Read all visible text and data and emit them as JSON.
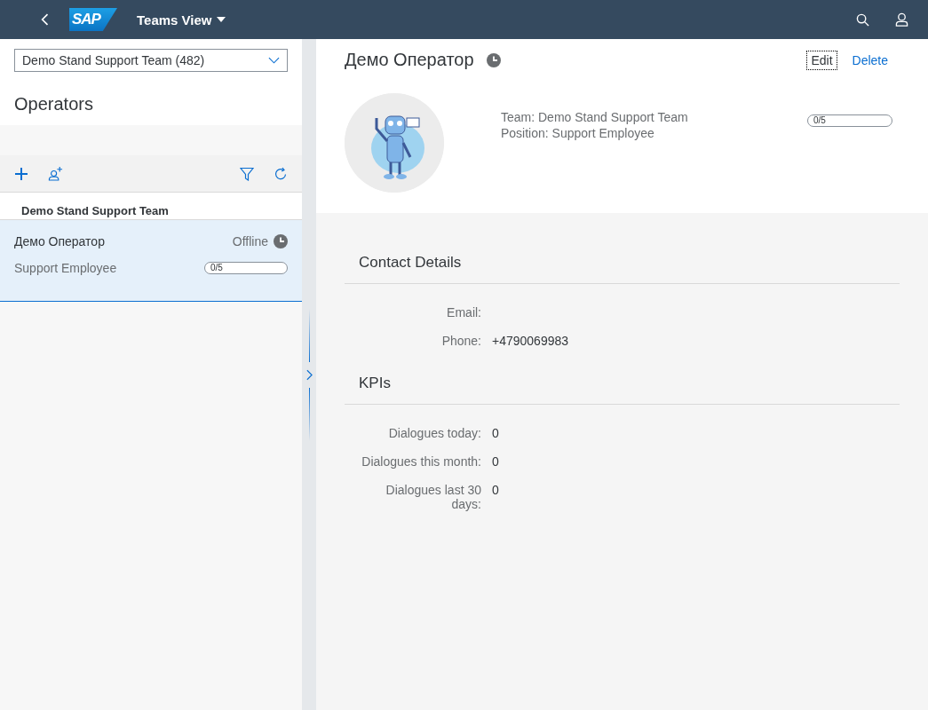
{
  "shell": {
    "logo": "SAP",
    "title": "Teams View"
  },
  "master": {
    "team_select": {
      "value": "Demo Stand Support Team (482)"
    },
    "title": "Operators",
    "group_header": "Demo Stand Support Team",
    "items": [
      {
        "name": "Демо Оператор",
        "status": "Offline",
        "position": "Support Employee",
        "load": "0/5",
        "level": 0,
        "selected": true
      }
    ]
  },
  "detail": {
    "title": "Демо Оператор",
    "actions": [
      {
        "label": "Edit",
        "focused": true
      },
      {
        "label": "Delete",
        "focused": false
      }
    ],
    "team": "Team: Demo Stand Support Team",
    "position": "Position: Support Employee",
    "load": "0/5",
    "level": 0,
    "sections": [
      {
        "title": "Contact Details",
        "fields": [
          {
            "label": "Email:"
          },
          {
            "label": "Phone:",
            "value": "+4790069983"
          }
        ]
      },
      {
        "title": "KPIs",
        "fields": [
          {
            "label": "Dialogues today:",
            "value": "0"
          },
          {
            "label": "Dialogues this month:",
            "value": "0"
          },
          {
            "label": "Dialogues last 30 days:",
            "value": "0"
          }
        ]
      }
    ]
  }
}
